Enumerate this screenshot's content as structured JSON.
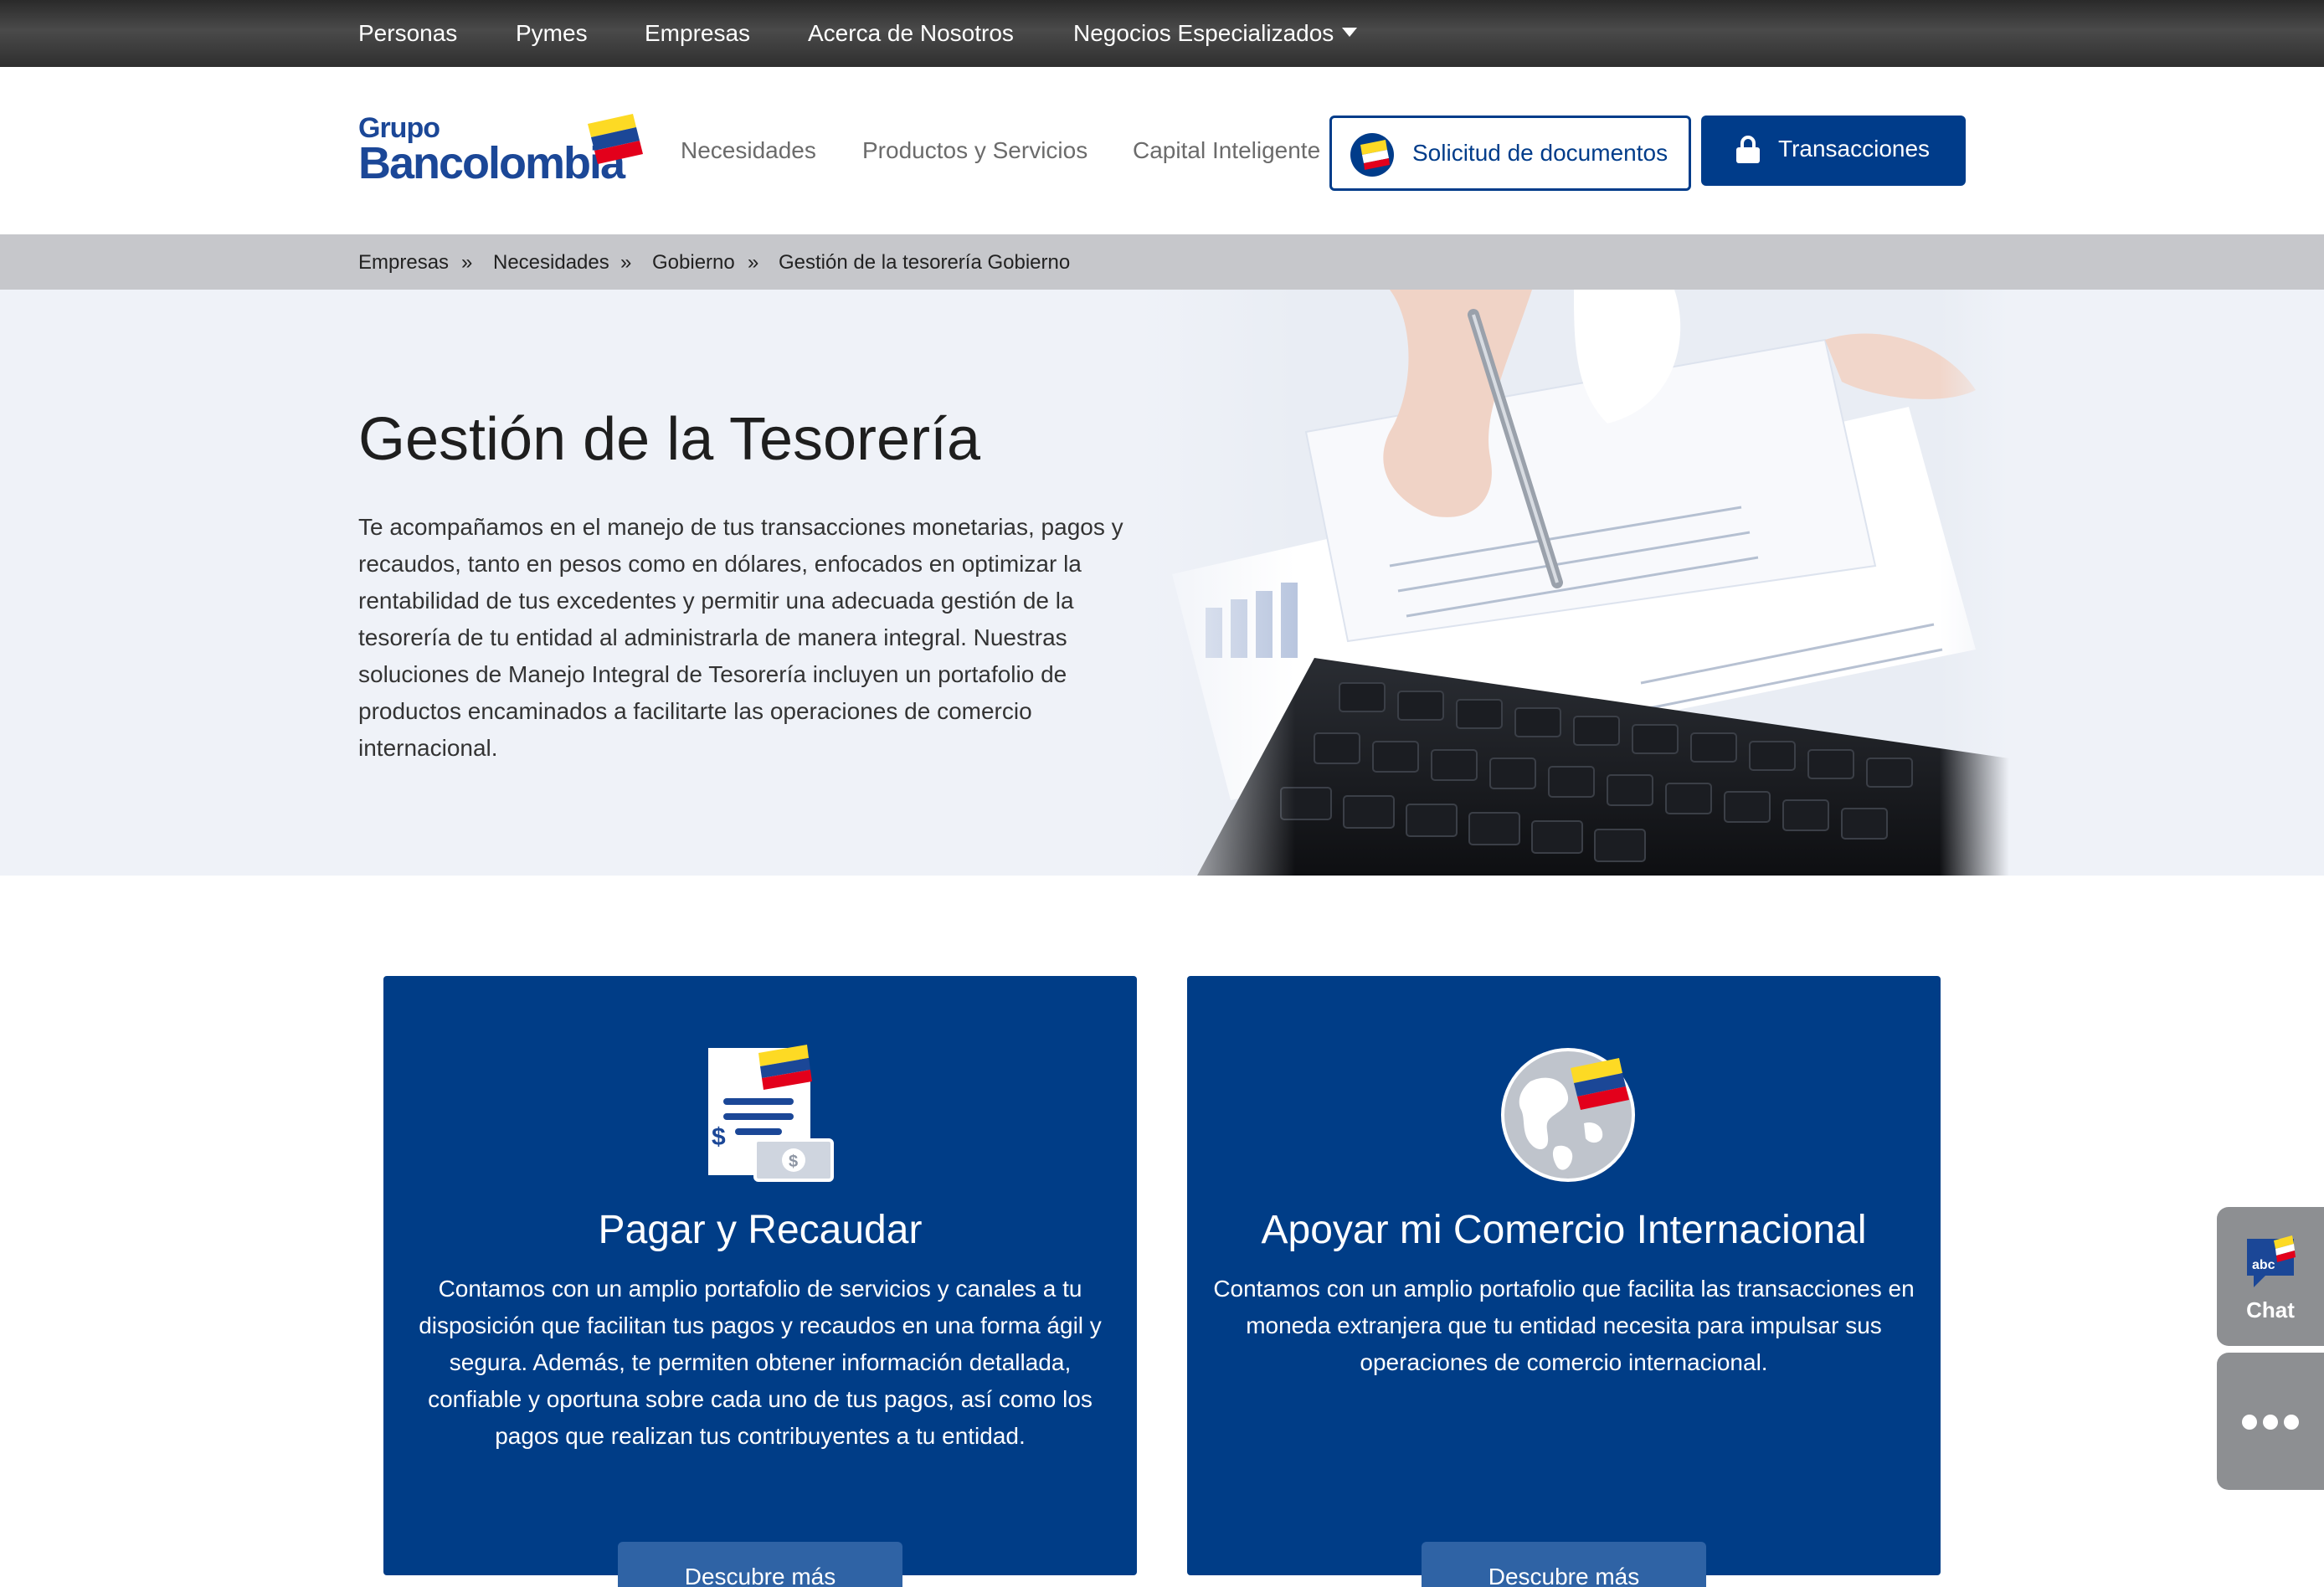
{
  "topbar": {
    "items": [
      "Personas",
      "Pymes",
      "Empresas",
      "Acerca de Nosotros",
      "Negocios Especializados"
    ]
  },
  "header": {
    "logo_grupo": "Grupo",
    "logo_brand": "Bancolombia",
    "nav": [
      "Necesidades",
      "Productos y Servicios",
      "Capital Inteligente"
    ],
    "docs_button": "Solicitud de documentos",
    "transactions_button": "Transacciones"
  },
  "breadcrumb": {
    "items": [
      "Empresas",
      "Necesidades",
      "Gobierno",
      "Gestión de la tesorería Gobierno"
    ],
    "separator": "»"
  },
  "hero": {
    "title": "Gestión de la Tesorería",
    "body": "Te acompañamos en el manejo de tus transacciones monetarias, pagos y recaudos, tanto en pesos como en dólares, enfocados en optimizar la rentabilidad de tus excedentes y permitir una adecuada gestión de la tesorería de tu entidad al administrarla de manera integral. Nuestras soluciones de Manejo Integral de Tesorería incluyen un portafolio de productos encaminados a facilitarte las operaciones de comercio internacional."
  },
  "cards": [
    {
      "icon": "invoice-payment-icon",
      "title": "Pagar y Recaudar",
      "body": "Contamos con un amplio portafolio de servicios y canales a tu disposición que facilitan tus pagos y recaudos en una forma  ágil y segura.  Además, te permiten obtener información detallada, confiable y oportuna sobre cada uno de tus pagos, así como los pagos que realizan tus contribuyentes a tu entidad.",
      "button": "Descubre más"
    },
    {
      "icon": "globe-icon",
      "title": "Apoyar mi Comercio Internacional",
      "body": "Contamos con un amplio portafolio que facilita las  transacciones en moneda extranjera que tu entidad necesita para impulsar sus operaciones de comercio internacional.",
      "button": "Descubre más"
    }
  ],
  "widgets": {
    "chat_icon_text": "abc",
    "chat_label": "Chat"
  },
  "colors": {
    "brand_blue": "#003d87",
    "brand_yellow": "#fdda24",
    "brand_red": "#e3001b",
    "topbar": "#3a3a3a",
    "breadcrumb_bg": "#c6c7cb"
  }
}
